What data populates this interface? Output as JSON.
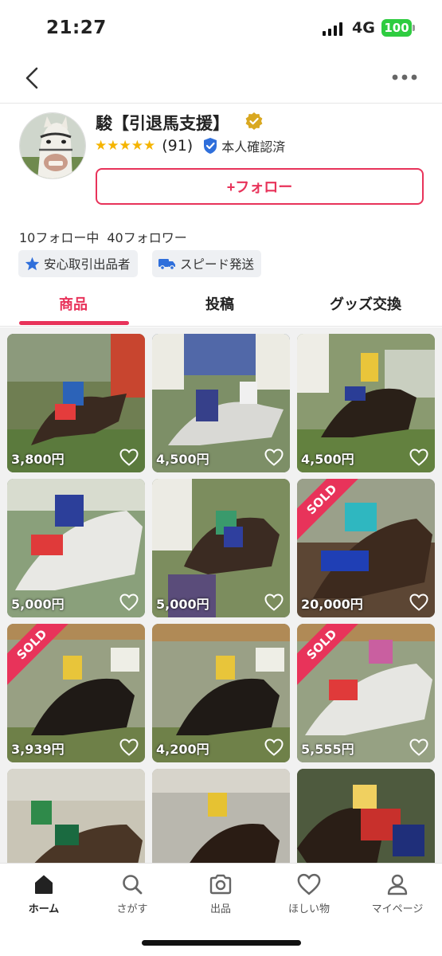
{
  "status_bar": {
    "time": "21:27",
    "network": "4G",
    "battery": "100"
  },
  "profile": {
    "name": "駿【引退馬支援】",
    "stars": "★★★★★",
    "rating_count": "(91)",
    "id_verified": "本人確認済",
    "follow_button": "+フォロー",
    "following": "10フォロー中",
    "followers": "40フォロワー",
    "tags": [
      "安心取引出品者",
      "スピード発送"
    ]
  },
  "tabs": [
    "商品",
    "投稿",
    "グッズ交換"
  ],
  "products": [
    {
      "price": "3,800円",
      "sold": false
    },
    {
      "price": "4,500円",
      "sold": false
    },
    {
      "price": "4,500円",
      "sold": false
    },
    {
      "price": "5,000円",
      "sold": false
    },
    {
      "price": "5,000円",
      "sold": false
    },
    {
      "price": "20,000円",
      "sold": true
    },
    {
      "price": "3,939円",
      "sold": true
    },
    {
      "price": "4,200円",
      "sold": false
    },
    {
      "price": "5,555円",
      "sold": true
    },
    {
      "price": "",
      "sold": false
    },
    {
      "price": "",
      "sold": false
    },
    {
      "price": "",
      "sold": false
    }
  ],
  "sold_label": "SOLD",
  "bottom_nav": [
    "ホーム",
    "さがす",
    "出品",
    "ほしい物",
    "マイページ"
  ],
  "colors": {
    "accent": "#e8335a",
    "star": "#f5b400",
    "verified": "#2f6fdb",
    "battery": "#2ecc40"
  }
}
